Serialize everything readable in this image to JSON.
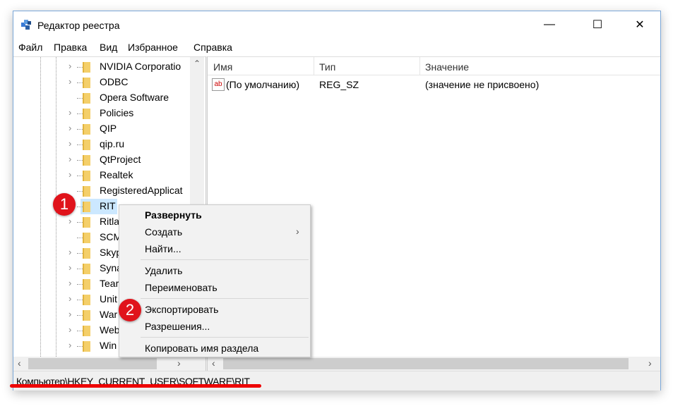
{
  "window": {
    "title": "Редактор реестра",
    "minimize": "—",
    "maximize": "☐",
    "close": "✕"
  },
  "menu": [
    "Файл",
    "Правка",
    "Вид",
    "Избранное",
    "Справка"
  ],
  "tree": {
    "items": [
      {
        "label": "NVIDIA Corporatio",
        "expandable": true
      },
      {
        "label": "ODBC",
        "expandable": true
      },
      {
        "label": "Opera Software",
        "expandable": false
      },
      {
        "label": "Policies",
        "expandable": true
      },
      {
        "label": "QIP",
        "expandable": true
      },
      {
        "label": "qip.ru",
        "expandable": true
      },
      {
        "label": "QtProject",
        "expandable": true
      },
      {
        "label": "Realtek",
        "expandable": true
      },
      {
        "label": "RegisteredApplicat",
        "expandable": false
      },
      {
        "label": "RIT",
        "expandable": false,
        "selected": true
      },
      {
        "label": "Ritla",
        "expandable": true
      },
      {
        "label": "SCM",
        "expandable": false
      },
      {
        "label": "Skyp",
        "expandable": true
      },
      {
        "label": "Syna",
        "expandable": true
      },
      {
        "label": "Tear",
        "expandable": true
      },
      {
        "label": "Unit",
        "expandable": true
      },
      {
        "label": "War",
        "expandable": true
      },
      {
        "label": "Web",
        "expandable": true
      },
      {
        "label": "Win",
        "expandable": true
      }
    ]
  },
  "values": {
    "columns": [
      "Имя",
      "Тип",
      "Значение"
    ],
    "rows": [
      {
        "name": "(По умолчанию)",
        "type": "REG_SZ",
        "value": "(значение не присвоено)",
        "icon": "ab"
      }
    ]
  },
  "context_menu": {
    "items": [
      "Развернуть",
      "Создать",
      "Найти...",
      "Удалить",
      "Переименовать",
      "Экспортировать",
      "Разрешения...",
      "Копировать имя раздела"
    ]
  },
  "badges": [
    "1",
    "2"
  ],
  "status": "Компьютер\\HKEY_CURRENT_USER\\SOFTWARE\\RIT",
  "colors": {
    "badge": "#e0131b",
    "selection": "#cce8ff",
    "underline": "#ee0000"
  }
}
